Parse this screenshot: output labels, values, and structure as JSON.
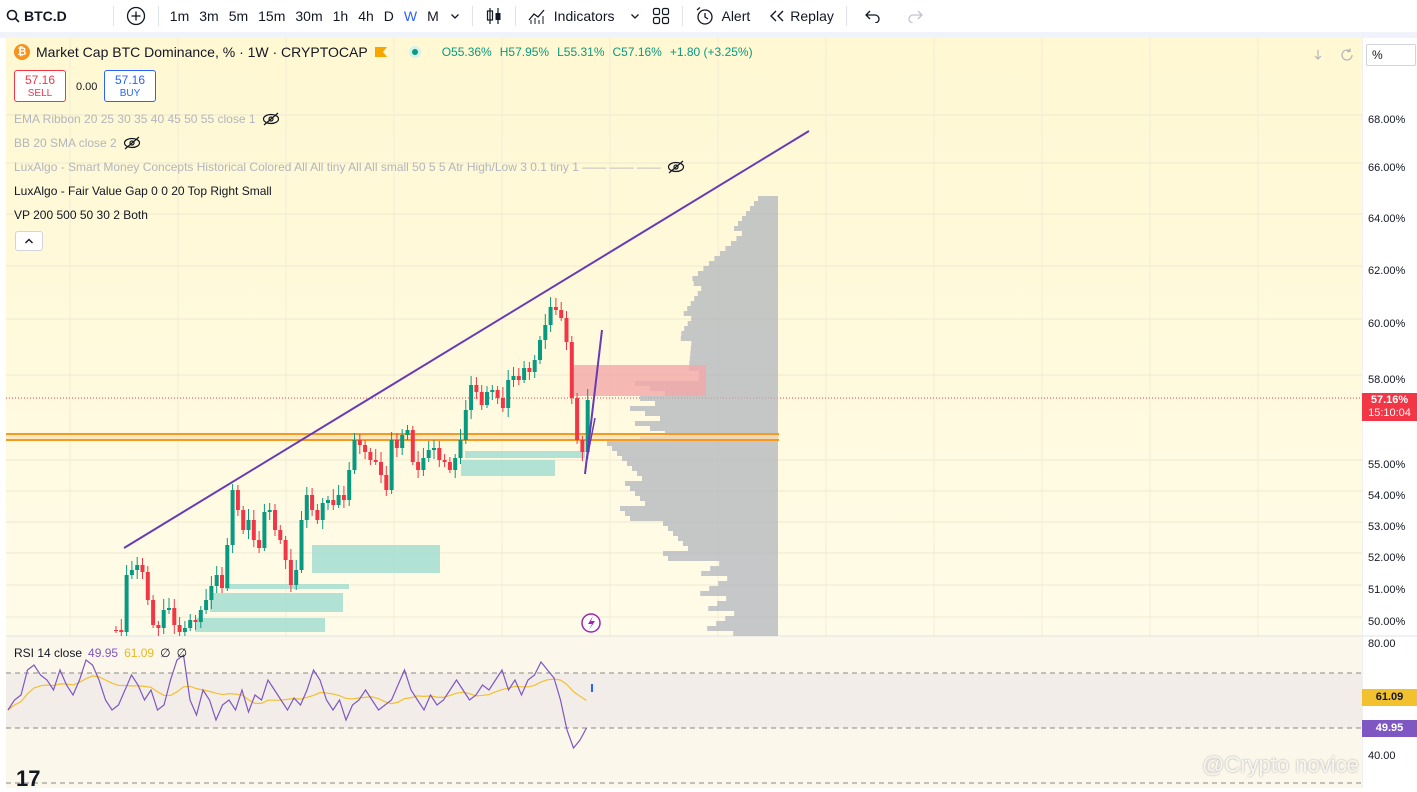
{
  "toolbar": {
    "symbol": "BTC.D",
    "timeframes": [
      "1m",
      "3m",
      "5m",
      "15m",
      "30m",
      "1h",
      "4h",
      "D",
      "W",
      "M"
    ],
    "active_timeframe": "W",
    "indicators_label": "Indicators",
    "alert_label": "Alert",
    "replay_label": "Replay"
  },
  "header": {
    "title": "Market Cap BTC Dominance, % · 1W · CRYPTOCAP",
    "open": "O55.36%",
    "high": "H57.95%",
    "low": "L55.31%",
    "close": "C57.16%",
    "change": "+1.80 (+3.25%)",
    "scale_mode": "%"
  },
  "trade": {
    "sell_price": "57.16",
    "sell_label": "SELL",
    "spread": "0.00",
    "buy_price": "57.16",
    "buy_label": "BUY"
  },
  "indicators": [
    {
      "label": "EMA Ribbon 20 25 30 35 40 45 50 55 close 1",
      "hidden": true
    },
    {
      "label": "BB 20 SMA close 2",
      "hidden": true
    },
    {
      "label": "LuxAlgo - Smart Money Concepts Historical Colored All All tiny All All small 50 5 5 Atr High/Low 3 0.1 tiny 1 —— —— ——",
      "hidden": true
    },
    {
      "label": "LuxAlgo - Fair Value Gap 0 0 20 Top Right Small",
      "hidden": false
    },
    {
      "label": "VP 200 500 50 30 2 Both",
      "hidden": false
    }
  ],
  "price_axis": {
    "labels": [
      "68.00%",
      "66.00%",
      "64.00%",
      "62.00%",
      "60.00%",
      "58.00%",
      "55.00%",
      "54.00%",
      "53.00%",
      "52.00%",
      "51.00%",
      "50.00%"
    ],
    "current_price": "57.16%",
    "countdown": "15:10:04"
  },
  "rsi": {
    "label": "RSI 14 close",
    "value": "49.95",
    "ma_value": "61.09",
    "extra1": "∅",
    "extra2": "∅",
    "axis_top": "80.00",
    "axis_bottom": "40.00",
    "tag_ma": "61.09",
    "tag_value": "49.95"
  },
  "watermark": "@Crypto novice",
  "logo": "17",
  "colors": {
    "up": "#089981",
    "down": "#f23645",
    "trendline": "#673ab7",
    "support": "#f59a23",
    "rsi_line": "#7e57c2",
    "rsi_ma": "#f2c12e",
    "volume_profile": "#b2b5be"
  }
}
